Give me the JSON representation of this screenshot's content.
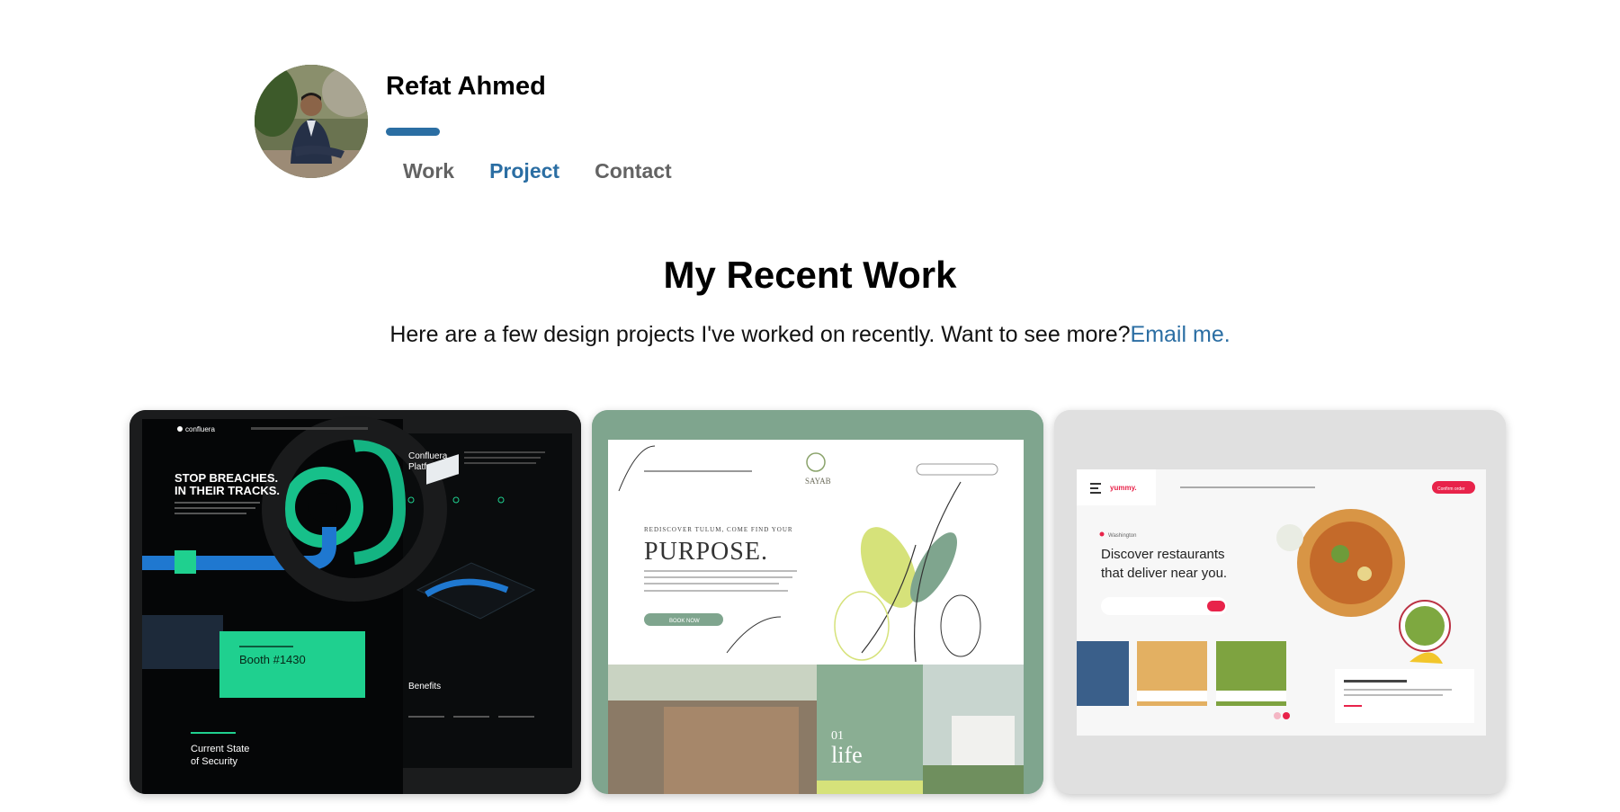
{
  "profile": {
    "name": "Refat Ahmed",
    "avatar_alt": "Refat Ahmed",
    "accent": "#2b6ea3"
  },
  "nav": {
    "items": [
      {
        "label": "Work",
        "active": false
      },
      {
        "label": "Project",
        "active": true
      },
      {
        "label": "Contact",
        "active": false
      }
    ]
  },
  "section": {
    "title": "My Recent Work",
    "subtitle": "Here are a few design projects I've worked on recently. Want to see more?",
    "email_link": "Email me."
  },
  "projects": [
    {
      "brand": "confluera",
      "headline_1": "STOP BREACHES.",
      "headline_2": "IN THEIR TRACKS.",
      "platform_1": "Confluera",
      "platform_2": "Platform",
      "booth": "Booth #1430",
      "benefits": "Benefits",
      "state_1": "Current State",
      "state_2": "of Security",
      "accent": "#1fd08f"
    },
    {
      "brand": "SAYAB",
      "kicker": "REDISCOVER TULUM, COME FIND YOUR",
      "headline": "PURPOSE.",
      "cta": "BOOK NOW",
      "num": "01",
      "life": "life",
      "accent": "#7fa58e"
    },
    {
      "brand": "yummy.",
      "headline_1": "Discover restaurants",
      "headline_2": "that deliver near you.",
      "location": "Washington",
      "cta": "Confirm order",
      "accent": "#e8234a"
    }
  ]
}
